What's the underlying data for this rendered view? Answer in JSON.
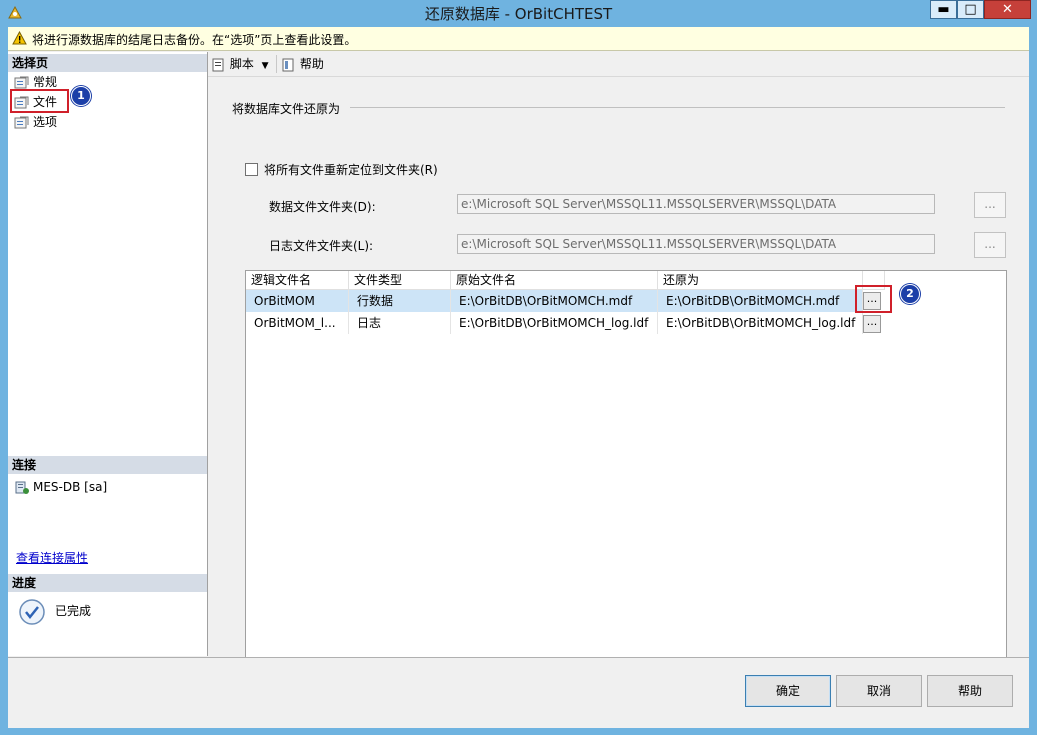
{
  "window": {
    "title": "还原数据库 - OrBitCHTEST",
    "min_glyph": "▬",
    "max_glyph": "□",
    "close_glyph": "✕"
  },
  "warning": {
    "text": "将进行源数据库的结尾日志备份。在“选项”页上查看此设置。",
    "icon": "warning-icon"
  },
  "left": {
    "select_page_header": "选择页",
    "pages": [
      {
        "label": "常规",
        "icon": "page-icon"
      },
      {
        "label": "文件",
        "icon": "page-icon"
      },
      {
        "label": "选项",
        "icon": "page-icon"
      }
    ],
    "connection_header": "连接",
    "connection": "MES-DB [sa]",
    "view_props_link": "查看连接属性",
    "progress_header": "进度",
    "progress_status": "已完成"
  },
  "toolbar": {
    "script_label": "脚本",
    "help_label": "帮助"
  },
  "section": {
    "title": "将数据库文件还原为",
    "relocate_label": "将所有文件重新定位到文件夹(R)",
    "relocate_checked": false,
    "data_folder_label": "数据文件文件夹(D):",
    "data_folder_value": "e:\\Microsoft SQL Server\\MSSQL11.MSSQLSERVER\\MSSQL\\DATA",
    "log_folder_label": "日志文件文件夹(L):",
    "log_folder_value": "e:\\Microsoft SQL Server\\MSSQL11.MSSQLSERVER\\MSSQL\\DATA",
    "browse_label": "..."
  },
  "grid": {
    "headers": [
      "逻辑文件名",
      "文件类型",
      "原始文件名",
      "还原为"
    ],
    "rows": [
      {
        "logical": "OrBitMOM",
        "type": "行数据",
        "original": "E:\\OrBitDB\\OrBitMOMCH.mdf",
        "restore_as": "E:\\OrBitDB\\OrBitMOMCH.mdf",
        "browse": "..."
      },
      {
        "logical": "OrBitMOM_l...",
        "type": "日志",
        "original": "E:\\OrBitDB\\OrBitMOMCH_log.ldf",
        "restore_as": "E:\\OrBitDB\\OrBitMOMCH_log.ldf",
        "browse": "..."
      }
    ]
  },
  "annotations": {
    "badge1": "1",
    "badge2": "2",
    "highlight_color": "#d0202a",
    "badge_color": "#1c3fa8"
  },
  "footer": {
    "ok": "确定",
    "cancel": "取消",
    "help": "帮助"
  }
}
